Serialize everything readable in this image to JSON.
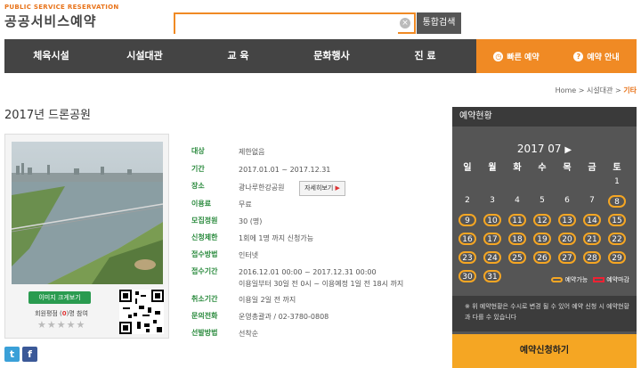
{
  "header": {
    "logo_sub": "PUBLIC SERVICE RESERVATION",
    "logo_main": "공공서비스예약",
    "search_value": "",
    "search_clear": "×",
    "search_button": "통합검색"
  },
  "nav": {
    "items": [
      "체육시설",
      "시설대관",
      "교 육",
      "문화행사",
      "진 료"
    ],
    "quick_label": "빠른 예약",
    "quick_icon": "clock-icon",
    "guide_label": "예약 안내",
    "guide_icon": "question-icon"
  },
  "breadcrumb": {
    "home": "Home",
    "sep": ">",
    "level1": "시설대관",
    "current": "기타"
  },
  "page_title": "2017년 드론공원",
  "card": {
    "enlarge_button": "이미지 크게보기",
    "rating_prefix": "회원평점 (",
    "rating_count": "0",
    "rating_suffix": ")명 참여",
    "stars": "★★★★★"
  },
  "info": [
    {
      "label": "대상",
      "value": "제한없음"
    },
    {
      "label": "기간",
      "value": "2017.01.01 ~ 2017.12.31"
    },
    {
      "label": "장소",
      "value": "광나루한강공원",
      "button": "자세히보기",
      "button_arrow": "▶"
    },
    {
      "label": "이용료",
      "value": "무료"
    },
    {
      "label": "모집정원",
      "value": "30 (명)"
    },
    {
      "label": "신청제한",
      "value": "1회에 1명 까지 신청가능"
    },
    {
      "label": "접수방법",
      "value": "인터넷"
    },
    {
      "label": "접수기간",
      "value": "2016.12.01 00:00 ~ 2017.12.31 00:00",
      "value2": "이용일부터 30일 전 0시 ~ 이용예정 1일 전 18시 까지"
    },
    {
      "label": "취소기간",
      "value": "이용일 2일 전 까지"
    },
    {
      "label": "문의전화",
      "value": "운영총괄과 / 02-3780-0808"
    },
    {
      "label": "선발방법",
      "value": "선착순"
    }
  ],
  "panel": {
    "title": "예약현황",
    "month": "2017 07",
    "next_arrow": "▶",
    "weekdays": [
      "일",
      "월",
      "화",
      "수",
      "목",
      "금",
      "토"
    ],
    "first_weekday": 6,
    "days_in_month": 31,
    "available_days": [
      8,
      9,
      10,
      11,
      12,
      13,
      14,
      15,
      16,
      17,
      18,
      19,
      20,
      21,
      22,
      23,
      24,
      25,
      26,
      27,
      28,
      29,
      30,
      31
    ],
    "available_color": "#f5a623",
    "legend_available": "예약가능",
    "legend_closed": "예약마감",
    "note": "※ 위 예약현황은 수시로 변경 될 수 있어 예약 신청 시 예약현황과 다를 수 있습니다",
    "apply_button": "예약신청하기"
  },
  "social": [
    {
      "name": "twitter-icon",
      "glyph": "t",
      "color": "#3aa0d8"
    },
    {
      "name": "facebook-icon",
      "glyph": "f",
      "color": "#3b5998"
    }
  ]
}
